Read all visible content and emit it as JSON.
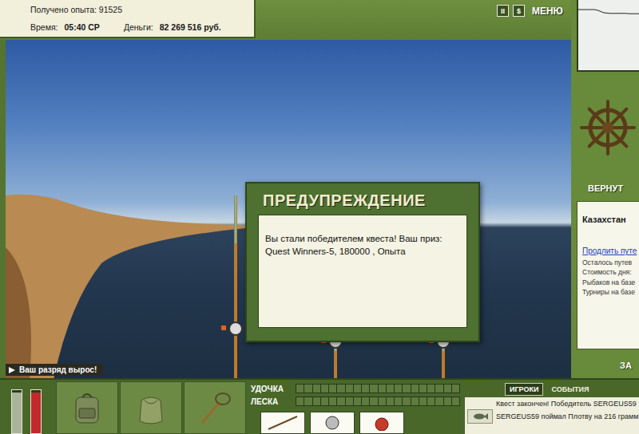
{
  "hud": {
    "experience": "Получено опыта: 91525",
    "time_label": "Время:",
    "time": "05:40 СР",
    "money_label": "Деньги:",
    "money": "82 269 516 руб."
  },
  "top_buttons": [
    {
      "label": "II",
      "kind": "square"
    },
    {
      "label": "$",
      "kind": "square"
    },
    {
      "label": "МЕНЮ",
      "kind": "text"
    }
  ],
  "dialog": {
    "title": "ПРЕДУПРЕЖДЕНИЕ",
    "message_lines": [
      "Вы стали победителем квеста! Ваш приз:",
      "Quest Winners-5, 180000 , Опыта"
    ]
  },
  "notice": "Ваш разряд вырос!",
  "depth_chart": {
    "values": [
      3,
      3,
      3,
      3,
      3,
      3,
      3.2,
      3.6,
      4,
      4.1,
      4.2,
      4.2,
      4.2,
      4.2,
      4.2,
      4.2,
      4.3,
      4.3,
      4.3,
      4.3
    ]
  },
  "side": {
    "return_button": "ВЕРНУТ",
    "location": "Казахстан",
    "extend_link": "Продлить путе",
    "info": [
      "Осталось путев",
      "Стоимость дня:",
      "Рыбаков на базе",
      "Турниры на базе"
    ],
    "bottom_button": "ЗА"
  },
  "gauges": [
    {
      "level": 0.95,
      "color": "#a9b49a"
    },
    {
      "level": 0.95,
      "color": "#c3282a"
    }
  ],
  "rod_meters": [
    {
      "label": "УДОЧКА",
      "level": 0
    },
    {
      "label": "ЛЕСКА",
      "level": 0
    }
  ],
  "tabs": [
    {
      "label": "ИГРОКИ",
      "selected": true
    },
    {
      "label": "СОБЫТИЯ",
      "selected": false
    }
  ],
  "messages": [
    {
      "text": "Квест закончен! Победитель SERGEUS59",
      "kind": "plain"
    },
    {
      "text": "SERGEUS59 поймал Плотву на 216 грамм",
      "kind": "catch"
    }
  ]
}
